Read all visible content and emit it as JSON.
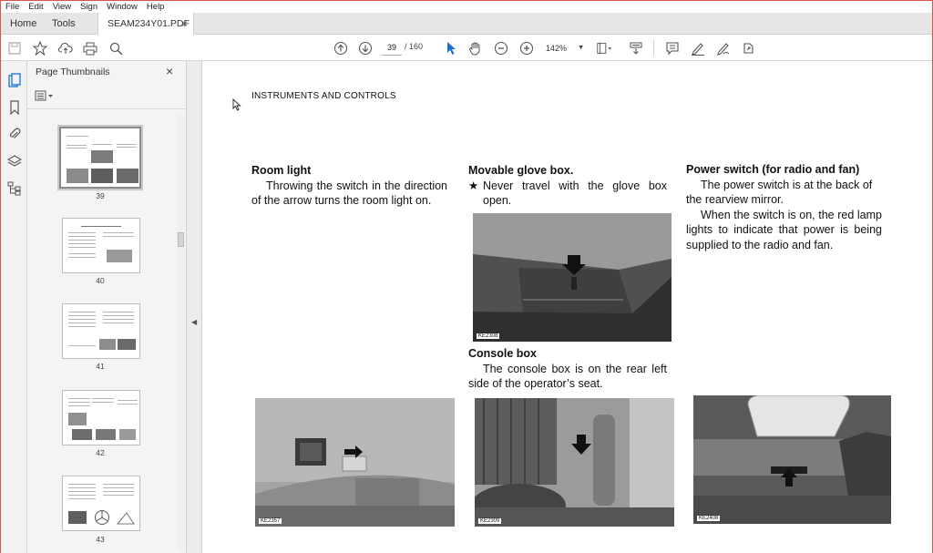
{
  "menu": [
    "File",
    "Edit",
    "View",
    "Sign",
    "Window",
    "Help"
  ],
  "tabs": {
    "home": "Home",
    "tools": "Tools",
    "document": "SEAM234Y01.PDF",
    "close": "×"
  },
  "toolbar": {
    "current_page": "39",
    "total_pages": "/ 160",
    "zoom": "142%"
  },
  "thumbnail_panel": {
    "title": "Page Thumbnails",
    "close": "×",
    "pages": [
      "39",
      "40",
      "41",
      "42",
      "43"
    ]
  },
  "page": {
    "header": "INSTRUMENTS AND CONTROLS",
    "room_light": {
      "title": "Room light",
      "body": "Throwing the switch in the direction of the arrow turns the room light on."
    },
    "glove_box": {
      "title": "Movable glove box.",
      "bullet": "★",
      "body": "Never travel with the glove box open."
    },
    "console_box": {
      "title": "Console box",
      "body": "The console box is on the rear left side of the operator’s seat."
    },
    "power_switch": {
      "title": "Power switch (for radio and fan)",
      "body1": "The power switch is at the back of the rearview mirror.",
      "body2": "When the switch is on, the red lamp lights to indicate that power is being supplied to the radio and fan."
    },
    "photo_labels": {
      "glove": "KE2308",
      "room": "KE2357",
      "console": "KE2309",
      "power": "KE2408"
    }
  },
  "colors": {
    "accent": "#d9534f",
    "toolbar_icon": "#555555",
    "selected_tool": "#1a6fd0"
  }
}
